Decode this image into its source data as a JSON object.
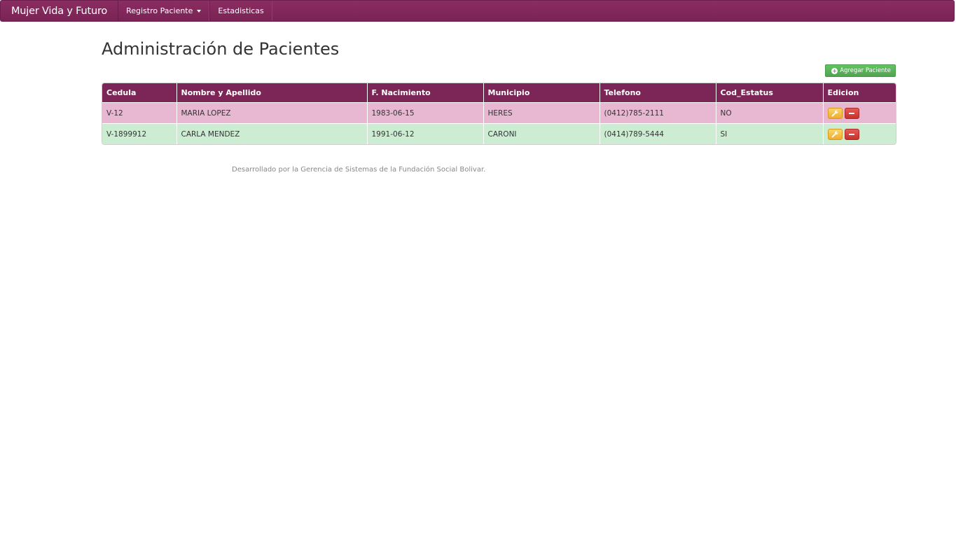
{
  "navbar": {
    "brand": "Mujer Vida y Futuro",
    "items": [
      {
        "label": "Registro Paciente",
        "dropdown": true
      },
      {
        "label": "Estadisticas",
        "dropdown": false
      }
    ],
    "color": "#7b2657"
  },
  "page": {
    "title": "Administración de Pacientes",
    "add_button_label": "Agregar Paciente"
  },
  "table": {
    "headers": [
      "Cedula",
      "Nombre y Apellido",
      "F. Nacimiento",
      "Municipio",
      "Telefono",
      "Cod_Estatus",
      "Edicion"
    ],
    "rows": [
      {
        "cedula": "V-12",
        "nombre": "MARIA LOPEZ",
        "nacimiento": "1983-06-15",
        "municipio": "HERES",
        "telefono": "(0412)785-2111",
        "estatus": "NO",
        "row_color": "#e8b8d3"
      },
      {
        "cedula": "V-1899912",
        "nombre": "CARLA MENDEZ",
        "nacimiento": "1991-06-12",
        "municipio": "CARONI",
        "telefono": "(0414)789-5444",
        "estatus": "SI",
        "row_color": "#cdedd3"
      }
    ]
  },
  "footer": {
    "text": "Desarrollado por la Gerencia de Sistemas de la Fundación Social Bolivar."
  }
}
